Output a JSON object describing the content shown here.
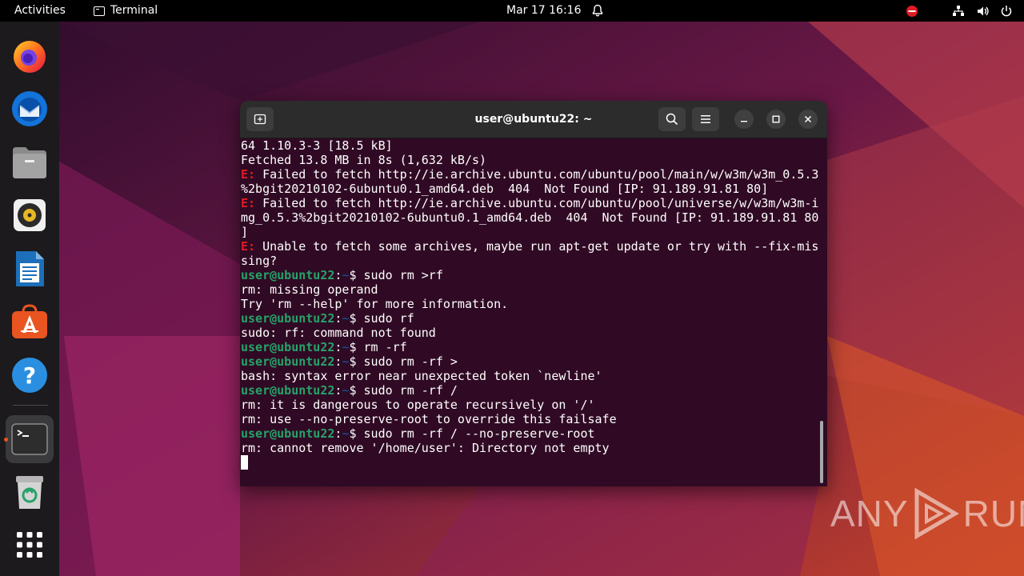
{
  "topbar": {
    "activities": "Activities",
    "app_name": "Terminal",
    "clock": "Mar 17  16:16"
  },
  "dock": {
    "items": [
      {
        "name": "firefox-icon"
      },
      {
        "name": "thunderbird-icon"
      },
      {
        "name": "files-icon"
      },
      {
        "name": "rhythmbox-icon"
      },
      {
        "name": "libreoffice-writer-icon"
      },
      {
        "name": "app-center-icon"
      },
      {
        "name": "help-icon"
      },
      {
        "name": "terminal-icon",
        "running": true
      },
      {
        "name": "trash-icon"
      },
      {
        "name": "show-apps-icon"
      }
    ]
  },
  "terminal": {
    "title": "user@ubuntu22: ~",
    "lines": [
      [
        {
          "t": "64 1.10.3-3 [18.5 kB]"
        }
      ],
      [
        {
          "t": "Fetched 13.8 MB in 8s (1,632 kB/s)"
        }
      ],
      [
        {
          "t": "E:",
          "c": "err"
        },
        {
          "t": " Failed to fetch http://ie.archive.ubuntu.com/ubuntu/pool/main/w/w3m/w3m_0.5.3"
        }
      ],
      [
        {
          "t": "%2bgit20210102-6ubuntu0.1_amd64.deb  404  Not Found [IP: 91.189.91.81 80]"
        }
      ],
      [
        {
          "t": "E:",
          "c": "err"
        },
        {
          "t": " Failed to fetch http://ie.archive.ubuntu.com/ubuntu/pool/universe/w/w3m/w3m-i"
        }
      ],
      [
        {
          "t": "mg_0.5.3%2bgit20210102-6ubuntu0.1_amd64.deb  404  Not Found [IP: 91.189.91.81 80"
        }
      ],
      [
        {
          "t": "]"
        }
      ],
      [
        {
          "t": "E:",
          "c": "err"
        },
        {
          "t": " Unable to fetch some archives, maybe run apt-get update or try with --fix-mis"
        }
      ],
      [
        {
          "t": "sing?"
        }
      ],
      [
        {
          "t": "user@ubuntu22",
          "c": "user"
        },
        {
          "t": ":"
        },
        {
          "t": "~",
          "c": "path"
        },
        {
          "t": "$ sudo rm >rf"
        }
      ],
      [
        {
          "t": "rm: missing operand"
        }
      ],
      [
        {
          "t": "Try 'rm --help' for more information."
        }
      ],
      [
        {
          "t": "user@ubuntu22",
          "c": "user"
        },
        {
          "t": ":"
        },
        {
          "t": "~",
          "c": "path"
        },
        {
          "t": "$ sudo rf"
        }
      ],
      [
        {
          "t": "sudo: rf: command not found"
        }
      ],
      [
        {
          "t": "user@ubuntu22",
          "c": "user"
        },
        {
          "t": ":"
        },
        {
          "t": "~",
          "c": "path"
        },
        {
          "t": "$ rm -rf"
        }
      ],
      [
        {
          "t": "user@ubuntu22",
          "c": "user"
        },
        {
          "t": ":"
        },
        {
          "t": "~",
          "c": "path"
        },
        {
          "t": "$ sudo rm -rf >"
        }
      ],
      [
        {
          "t": "bash: syntax error near unexpected token `newline'"
        }
      ],
      [
        {
          "t": "user@ubuntu22",
          "c": "user"
        },
        {
          "t": ":"
        },
        {
          "t": "~",
          "c": "path"
        },
        {
          "t": "$ sudo rm -rf /"
        }
      ],
      [
        {
          "t": "rm: it is dangerous to operate recursively on '/'"
        }
      ],
      [
        {
          "t": "rm: use --no-preserve-root to override this failsafe"
        }
      ],
      [
        {
          "t": "user@ubuntu22",
          "c": "user"
        },
        {
          "t": ":"
        },
        {
          "t": "~",
          "c": "path"
        },
        {
          "t": "$ sudo rm -rf / --no-preserve-root"
        }
      ],
      [
        {
          "t": "rm: cannot remove '/home/user': Directory not empty"
        }
      ],
      []
    ]
  },
  "watermark": {
    "left": "ANY",
    "right": "RUN"
  },
  "colors": {
    "terminal_bg": "#300a24",
    "error": "#e01b24",
    "prompt_user": "#26a269",
    "prompt_path": "#12488b",
    "accent": "#e95420"
  }
}
